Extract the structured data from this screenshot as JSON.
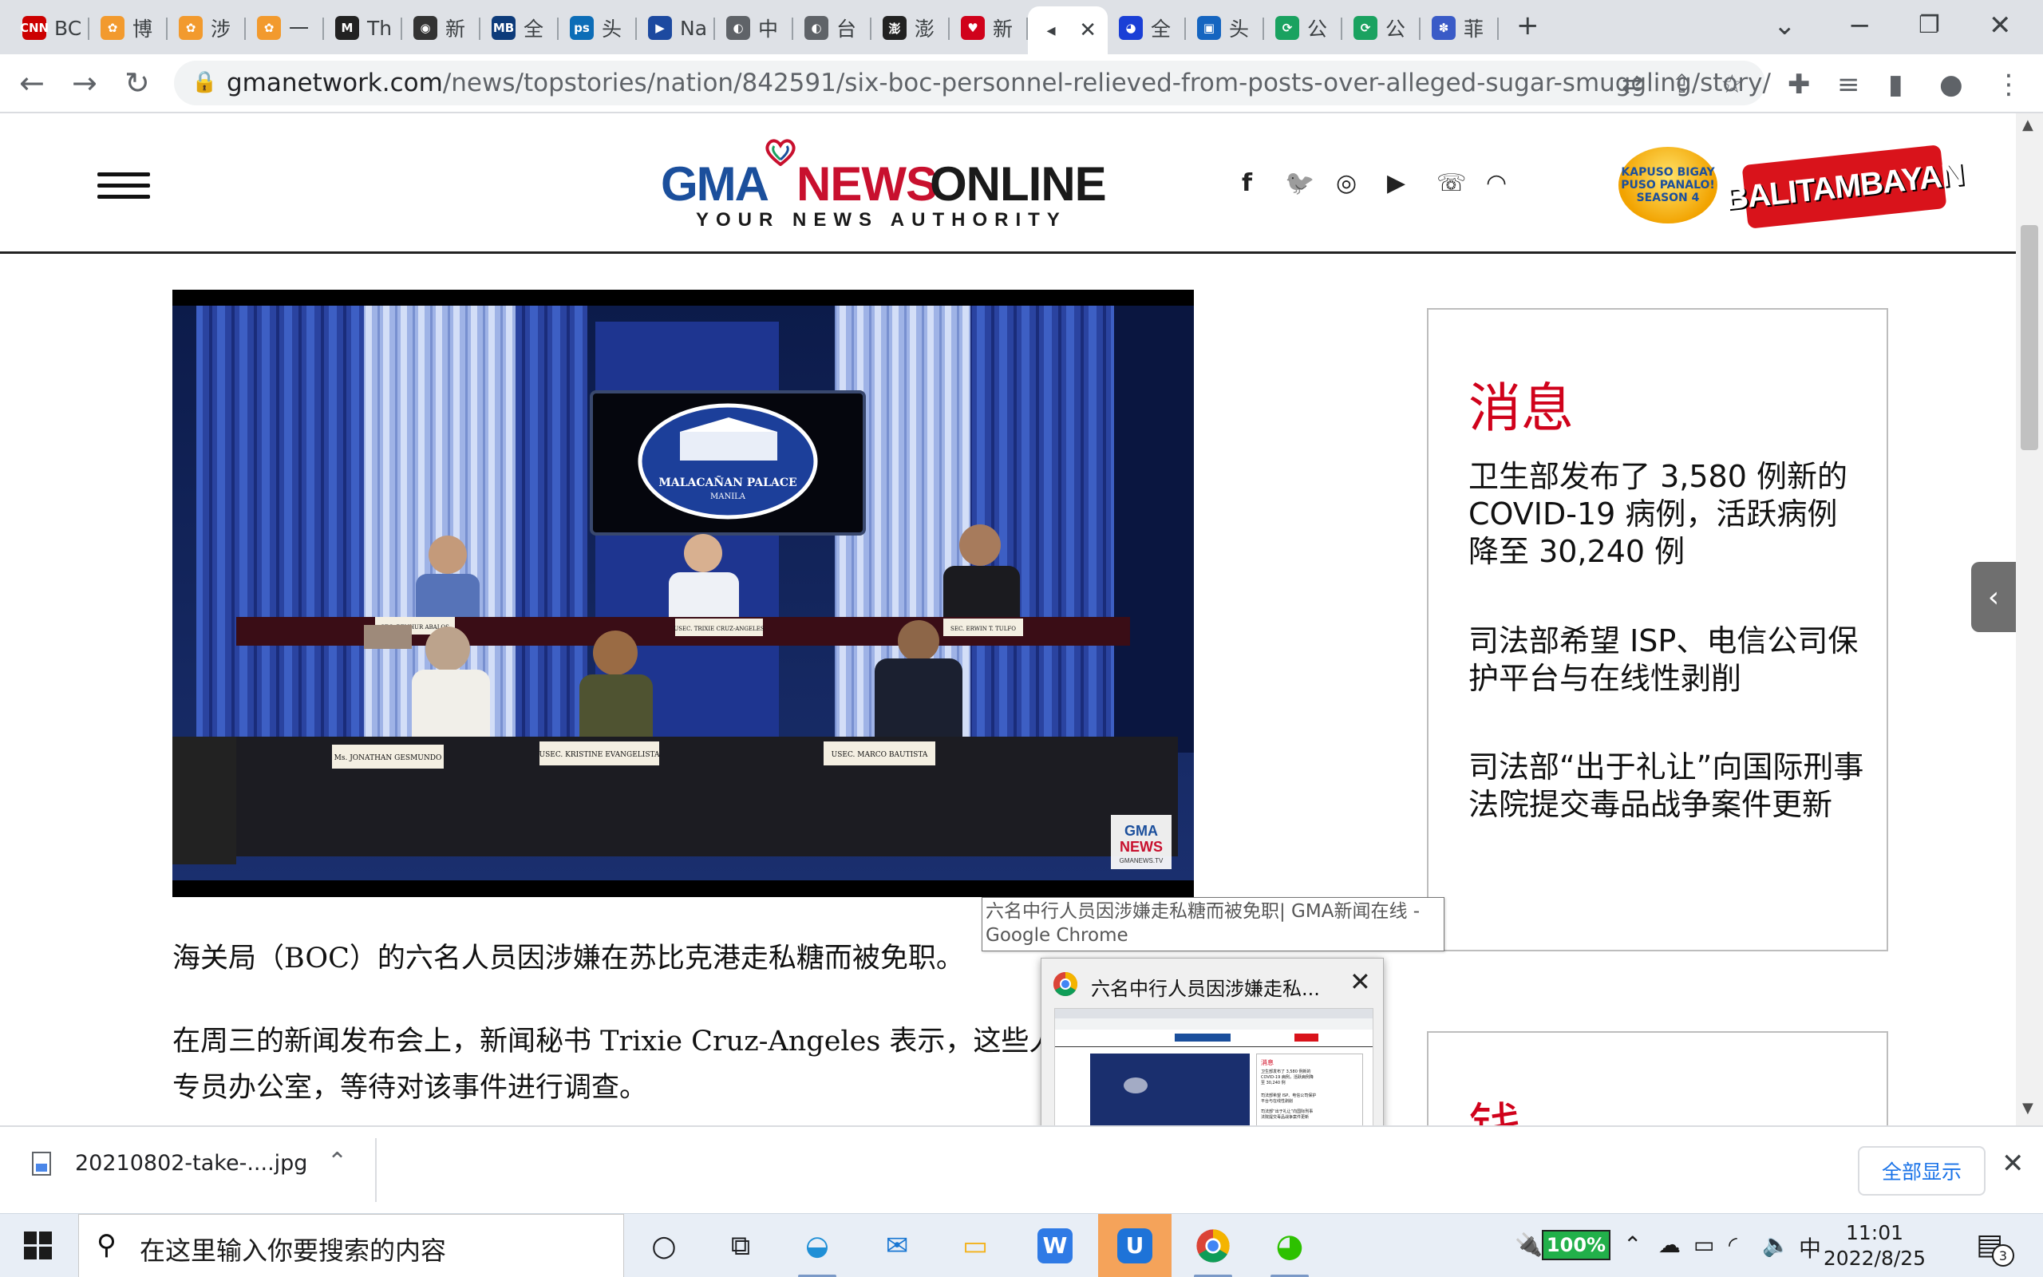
{
  "browser": {
    "tabs": [
      {
        "label": "BC",
        "fav_text": "CNN",
        "fav_color": "#cc0000"
      },
      {
        "label": "博",
        "fav_text": "✿",
        "fav_color": "#f29a2e"
      },
      {
        "label": "涉",
        "fav_text": "✿",
        "fav_color": "#f29a2e"
      },
      {
        "label": "一",
        "fav_text": "✿",
        "fav_color": "#f29a2e"
      },
      {
        "label": "Th",
        "fav_text": "M",
        "fav_color": "#222222"
      },
      {
        "label": "新",
        "fav_text": "◉",
        "fav_color": "#333333"
      },
      {
        "label": "全",
        "fav_text": "MB",
        "fav_color": "#0d3b7a"
      },
      {
        "label": "头",
        "fav_text": "ps",
        "fav_color": "#0c6db7"
      },
      {
        "label": "Na",
        "fav_text": "▶",
        "fav_color": "#1d4aa0"
      },
      {
        "label": "中",
        "fav_text": "◐",
        "fav_color": "#5f6368"
      },
      {
        "label": "台",
        "fav_text": "◐",
        "fav_color": "#5f6368"
      },
      {
        "label": "澎",
        "fav_text": "澎",
        "fav_color": "#222222"
      },
      {
        "label": "新",
        "fav_text": "♥",
        "fav_color": "#d0021b"
      },
      {
        "label": "",
        "fav_text": "◂",
        "fav_color": "#ffffff",
        "active": true
      },
      {
        "label": "全",
        "fav_text": "◕",
        "fav_color": "#1a3fd6"
      },
      {
        "label": "头",
        "fav_text": "▣",
        "fav_color": "#1565c0"
      },
      {
        "label": "公",
        "fav_text": "⟳",
        "fav_color": "#1aa260"
      },
      {
        "label": "公",
        "fav_text": "⟳",
        "fav_color": "#1aa260"
      },
      {
        "label": "菲",
        "fav_text": "✽",
        "fav_color": "#3a5bc7"
      }
    ],
    "new_tab": "+",
    "url_host": "gmanetwork.com",
    "url_path": "/news/topstories/nation/842591/six-boc-personnel-relieved-from-posts-over-alleged-sugar-smuggling/story/"
  },
  "site": {
    "logo_gma": "GMA",
    "logo_news": "NEWS",
    "logo_online": "ONLINE",
    "logo_tagline": "YOUR NEWS AUTHORITY",
    "social": [
      "f",
      "🐦",
      "◎",
      "▶",
      "☏",
      "◠"
    ],
    "promo1_text": "KAPUSO BIGAY PUSO PANALO! SEASON 4",
    "promo2_text": "BALITAMBAYAN"
  },
  "video": {
    "seal_name": "MALACAÑAN PALACE",
    "seal_sub": "MANILA",
    "watermark_gma": "GMA",
    "watermark_news": "NEWS",
    "watermark_site": "GMANEWS.TV",
    "nameplates": [
      "SEC. BENHUR ABALOS",
      "USEC. TRIXIE CRUZ-ANGELES",
      "SEC. ERWIN T. TULFO",
      "Ms. JONATHAN GESMUNDO",
      "USEC. KRISTINE EVANGELISTA",
      "USEC. MARCO BAUTISTA"
    ]
  },
  "article": {
    "p1": "海关局（BOC）的六名人员因涉嫌在苏比克港走私糖而被免职。",
    "p2_line1": "在周三的新闻发布会上，新闻秘书 Trixie Cruz-Angeles 表示，这些人",
    "p2_line2": "专员办公室，等待对该事件进行调查。"
  },
  "sidebar": {
    "heading": "消息",
    "items": [
      "卫生部发布了 3,580 例新的 COVID-19 病例，活跃病例降至 30,240 例",
      "司法部希望 ISP、电信公司保护平台与在线性剥削",
      "司法部“出于礼让”向国际刑事法院提交毒品战争案件更新"
    ],
    "heading2": "钱"
  },
  "tooltip": {
    "line1": "六名中行人员因涉嫌走私糖而被免职| GMA新闻在线 -",
    "line2": "Google Chrome"
  },
  "preview": {
    "title": "六名中行人员因涉嫌走私...",
    "mini_heading": "消息",
    "mini_item1": "卫生部发布了 3,580 例新的 COVID-19 病例，活跃病例降至 30,240 例",
    "mini_item2": "司法部希望 ISP、电信公司保护平台与在线性剥削",
    "mini_item3": "司法部“出于礼让”向国际刑事法院提交毒品战争案件更新"
  },
  "downloads": {
    "file_name": "20210802-take-....jpg",
    "show_all": "全部显示"
  },
  "taskbar": {
    "search_placeholder": "在这里输入你要搜索的内容",
    "battery": "100%",
    "ime": "中",
    "time": "11:01",
    "date": "2022/8/25",
    "notif_count": "3"
  }
}
